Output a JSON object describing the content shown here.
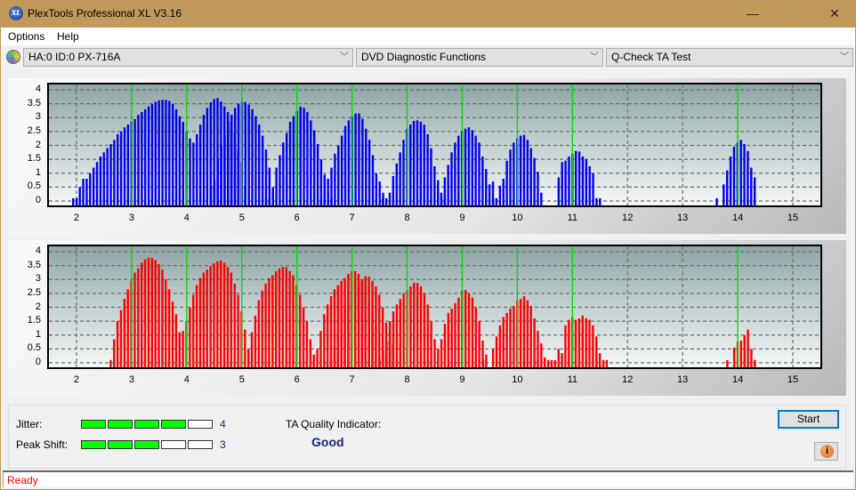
{
  "window": {
    "title": "PlexTools Professional XL V3.16",
    "app_icon_label": "XL",
    "controls": {
      "minimize": "—",
      "maximize": "☐",
      "close": "✕"
    }
  },
  "menu": {
    "items": [
      "Options",
      "Help"
    ]
  },
  "toolbar": {
    "drive": "HA:0 ID:0  PX-716A",
    "function": "DVD Diagnostic Functions",
    "test": "Q-Check TA Test",
    "chevron": "﹀"
  },
  "results": {
    "jitter_label": "Jitter:",
    "jitter_value": "4",
    "jitter_level": 4,
    "peak_shift_label": "Peak Shift:",
    "peak_shift_value": "3",
    "peak_shift_level": 3,
    "meter_segments": 5,
    "ta_quality_label": "TA Quality Indicator:",
    "ta_quality_value": "Good"
  },
  "buttons": {
    "start": "Start",
    "info": "i"
  },
  "status": {
    "text": "Ready"
  },
  "colors": {
    "land_bars": "#0000ee",
    "pit_bars": "#ff0000",
    "reference_lines": "#00e000",
    "meter_on": "#00ff00",
    "quality_text": "#1a237e"
  },
  "chart_data": [
    {
      "type": "bar",
      "title": "",
      "series_name": "Land (top)",
      "xlabel": "",
      "ylabel": "",
      "xlim": [
        1.5,
        15.5
      ],
      "ylim": [
        0,
        4
      ],
      "yticks": [
        "0",
        "0.5",
        "1",
        "1.5",
        "2",
        "2.5",
        "3",
        "3.5",
        "4"
      ],
      "xticks": [
        "2",
        "3",
        "4",
        "5",
        "6",
        "7",
        "8",
        "9",
        "10",
        "11",
        "12",
        "13",
        "14",
        "15"
      ],
      "reference_lines": [
        3,
        4,
        5,
        6,
        7,
        8,
        9,
        10,
        11,
        14
      ],
      "grid": true,
      "peaks": [
        {
          "start": 1.94,
          "end": 2.0,
          "vals": [
            0.1,
            0.1
          ]
        },
        {
          "start": 2.06,
          "vals": [
            0.5,
            0.8,
            0.8,
            1.0,
            1.2,
            1.4,
            1.6,
            1.75,
            1.9,
            2.05,
            2.2,
            2.4,
            2.5,
            2.65,
            2.75,
            2.85,
            2.95,
            3.1,
            3.2,
            3.3,
            3.4,
            3.5,
            3.57,
            3.62,
            3.64,
            3.64,
            3.6,
            3.5,
            3.3,
            3.05,
            2.85,
            2.5,
            2.25,
            2.1,
            2.4,
            2.75,
            3.1,
            3.35,
            3.55,
            3.67,
            3.7,
            3.58,
            3.4,
            3.2,
            2.85,
            2.45,
            1.85,
            1.4,
            0.5
          ]
        },
        {
          "start": 4.44,
          "vals": [
            0.5,
            0.75,
            1.5,
            2.0,
            2.35,
            2.85,
            3.1,
            3.35,
            3.5,
            3.57,
            3.56,
            3.47,
            3.3,
            3.05,
            2.75,
            2.35,
            1.85,
            1.2,
            0.5
          ]
        },
        {
          "start": 5.44,
          "vals": [
            0.1,
            0.1,
            0.35,
            1.2,
            1.65,
            2.1,
            2.45,
            2.85,
            3.05,
            3.25,
            3.4,
            3.35,
            3.2,
            2.9,
            2.55,
            2.05,
            1.5,
            0.95,
            0.3,
            0.1
          ]
        },
        {
          "start": 6.44,
          "vals": [
            0.1,
            0.3,
            0.8,
            1.2,
            1.7,
            2.0,
            2.35,
            2.7,
            2.9,
            3.05,
            3.15,
            3.15,
            2.95,
            2.6,
            2.2,
            1.65,
            1.0,
            0.7,
            0.3
          ]
        },
        {
          "start": 7.56,
          "vals": [
            0.1,
            0.1,
            0.3,
            0.9,
            1.35,
            1.75,
            2.2,
            2.6,
            2.75,
            2.88,
            2.9,
            2.85,
            2.75,
            2.4,
            1.9,
            1.25,
            0.75,
            0.1,
            0.1
          ]
        },
        {
          "start": 8.62,
          "vals": [
            0.3,
            0.85,
            1.3,
            1.75,
            2.1,
            2.35,
            2.5,
            2.6,
            2.65,
            2.55,
            2.35,
            2.1,
            1.6,
            1.15,
            0.6,
            0.7,
            0.1
          ]
        },
        {
          "start": 9.56,
          "vals": [
            0.1,
            0.0,
            0.55,
            0.8,
            1.45,
            1.85,
            2.1,
            2.25,
            2.35,
            2.38,
            2.2,
            1.9,
            1.55,
            1.05,
            0.3
          ]
        },
        {
          "start": 10.75,
          "vals": [
            0.85,
            1.4,
            1.45,
            1.6,
            1.7,
            1.8,
            1.78,
            1.6,
            1.5,
            1.25,
            1.0,
            0.1,
            0.1
          ]
        },
        {
          "start": 13.62,
          "vals": [
            0.1,
            0.0,
            0.6,
            1.1,
            1.6,
            1.95,
            2.1,
            2.2,
            2.05,
            1.8,
            1.2,
            0.85
          ]
        }
      ]
    },
    {
      "type": "bar",
      "title": "",
      "series_name": "Pit (bottom)",
      "xlabel": "",
      "ylabel": "",
      "xlim": [
        1.5,
        15.5
      ],
      "ylim": [
        0,
        4
      ],
      "yticks": [
        "0",
        "0.5",
        "1",
        "1.5",
        "2",
        "2.5",
        "3",
        "3.5",
        "4"
      ],
      "xticks": [
        "2",
        "3",
        "4",
        "5",
        "6",
        "7",
        "8",
        "9",
        "10",
        "11",
        "12",
        "13",
        "14",
        "15"
      ],
      "reference_lines": [
        3,
        4,
        5,
        6,
        7,
        8,
        9,
        10,
        11,
        14
      ],
      "grid": true,
      "peaks": [
        {
          "start": 2.62,
          "vals": [
            0.1,
            0.85,
            1.5,
            1.9,
            2.3,
            2.65,
            2.95,
            3.25,
            3.4,
            3.6,
            3.72,
            3.78,
            3.78,
            3.7,
            3.55,
            3.35,
            3.0,
            2.65,
            2.2,
            1.75,
            1.1,
            1.15,
            1.5,
            2.0,
            2.45,
            2.8,
            3.05,
            3.25,
            3.35,
            3.48,
            3.58,
            3.65,
            3.68,
            3.6,
            3.45,
            3.25,
            2.85,
            2.45,
            1.85,
            1.2,
            0.5,
            1.1,
            1.7,
            2.25,
            2.6,
            2.85,
            3.05,
            3.15,
            3.3,
            3.4,
            3.45,
            3.45,
            3.3,
            3.15,
            2.8,
            2.45,
            2.0,
            1.5,
            0.85,
            0.3,
            0.5,
            1.15,
            1.75,
            2.1,
            2.4,
            2.65,
            2.8,
            2.95,
            3.05,
            3.2,
            3.3,
            3.3,
            3.2,
            2.95,
            2.65,
            2.25,
            1.75,
            1.35,
            0.3,
            0.6,
            0.3
          ]
        },
        {
          "start": 6.62,
          "vals": [
            0.15,
            0.6,
            1.1,
            1.85,
            2.05,
            2.4,
            2.6,
            2.75,
            2.85,
            3.0,
            3.12,
            3.1,
            2.95,
            2.75,
            2.45,
            2.0,
            1.45,
            0.8,
            0.7
          ]
        },
        {
          "start": 7.5,
          "vals": [
            0.15,
            0.45,
            0.75,
            1.5,
            1.85,
            2.1,
            2.3,
            2.5,
            2.6,
            2.75,
            2.88,
            2.87,
            2.75,
            2.5,
            2.1,
            1.5,
            0.85,
            0.5
          ]
        },
        {
          "start": 8.56,
          "vals": [
            0.0,
            0.85,
            1.4,
            1.8,
            1.95,
            2.15,
            2.35,
            2.6,
            2.62,
            2.5,
            2.35,
            2.0,
            1.5,
            0.8,
            0.3
          ]
        },
        {
          "start": 9.38,
          "vals": [
            0.1
          ]
        },
        {
          "start": 9.56,
          "vals": [
            0.5,
            0.95,
            1.35,
            1.65,
            1.8,
            1.95,
            2.05,
            2.25,
            2.3,
            2.4,
            2.25,
            2.05,
            1.6,
            1.15,
            0.7,
            0.2
          ]
        },
        {
          "start": 10.31,
          "vals": [
            0.1,
            0.1
          ]
        },
        {
          "start": 10.56,
          "vals": [
            0.1,
            0.1,
            0.1,
            0.5,
            0.35,
            1.35,
            1.55,
            1.65,
            1.55,
            1.6,
            1.7,
            1.6,
            1.55,
            1.35,
            0.95,
            0.35,
            0.1,
            0.1
          ]
        },
        {
          "start": 13.81,
          "vals": [
            0.1,
            0.0,
            0.55,
            0.75,
            0.8,
            1.0,
            1.2,
            0.5,
            0.1
          ]
        }
      ]
    }
  ]
}
